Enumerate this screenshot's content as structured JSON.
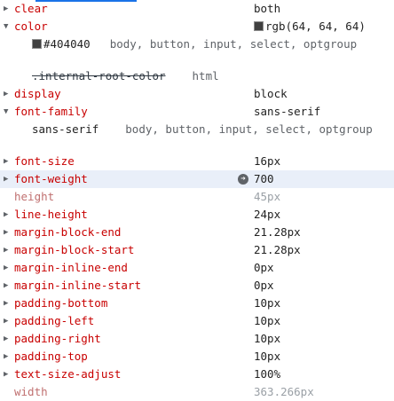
{
  "computed_styles": {
    "clear": {
      "name": "clear",
      "value": "both"
    },
    "color": {
      "name": "color",
      "value": "rgb(64, 64, 64)",
      "swatch_color": "#404040",
      "trace_value": "#404040",
      "trace_selector": "body, button, input, select, optgroup",
      "overridden_value": ".internal-root-color",
      "overridden_selector": "html"
    },
    "display": {
      "name": "display",
      "value": "block"
    },
    "font_family": {
      "name": "font-family",
      "value": "sans-serif",
      "trace_value": "sans-serif",
      "trace_selector": "body, button, input, select, optgroup"
    },
    "font_size": {
      "name": "font-size",
      "value": "16px"
    },
    "font_weight": {
      "name": "font-weight",
      "value": "700"
    },
    "height": {
      "name": "height",
      "value": "45px"
    },
    "line_height": {
      "name": "line-height",
      "value": "24px"
    },
    "margin_block_end": {
      "name": "margin-block-end",
      "value": "21.28px"
    },
    "margin_block_start": {
      "name": "margin-block-start",
      "value": "21.28px"
    },
    "margin_inline_end": {
      "name": "margin-inline-end",
      "value": "0px"
    },
    "margin_inline_start": {
      "name": "margin-inline-start",
      "value": "0px"
    },
    "padding_bottom": {
      "name": "padding-bottom",
      "value": "10px"
    },
    "padding_left": {
      "name": "padding-left",
      "value": "10px"
    },
    "padding_right": {
      "name": "padding-right",
      "value": "10px"
    },
    "padding_top": {
      "name": "padding-top",
      "value": "10px"
    },
    "text_size_adjust": {
      "name": "text-size-adjust",
      "value": "100%"
    },
    "width": {
      "name": "width",
      "value": "363.266px"
    }
  },
  "icons": {
    "expanded_arrow": "▼",
    "collapsed_arrow": "▶",
    "goto_arrow": "➜"
  },
  "colors": {
    "property_name": "#c80000",
    "inherited_property": "#c07070",
    "highlight_row": "#e9eff9",
    "tab_accent": "#1a73e8"
  }
}
